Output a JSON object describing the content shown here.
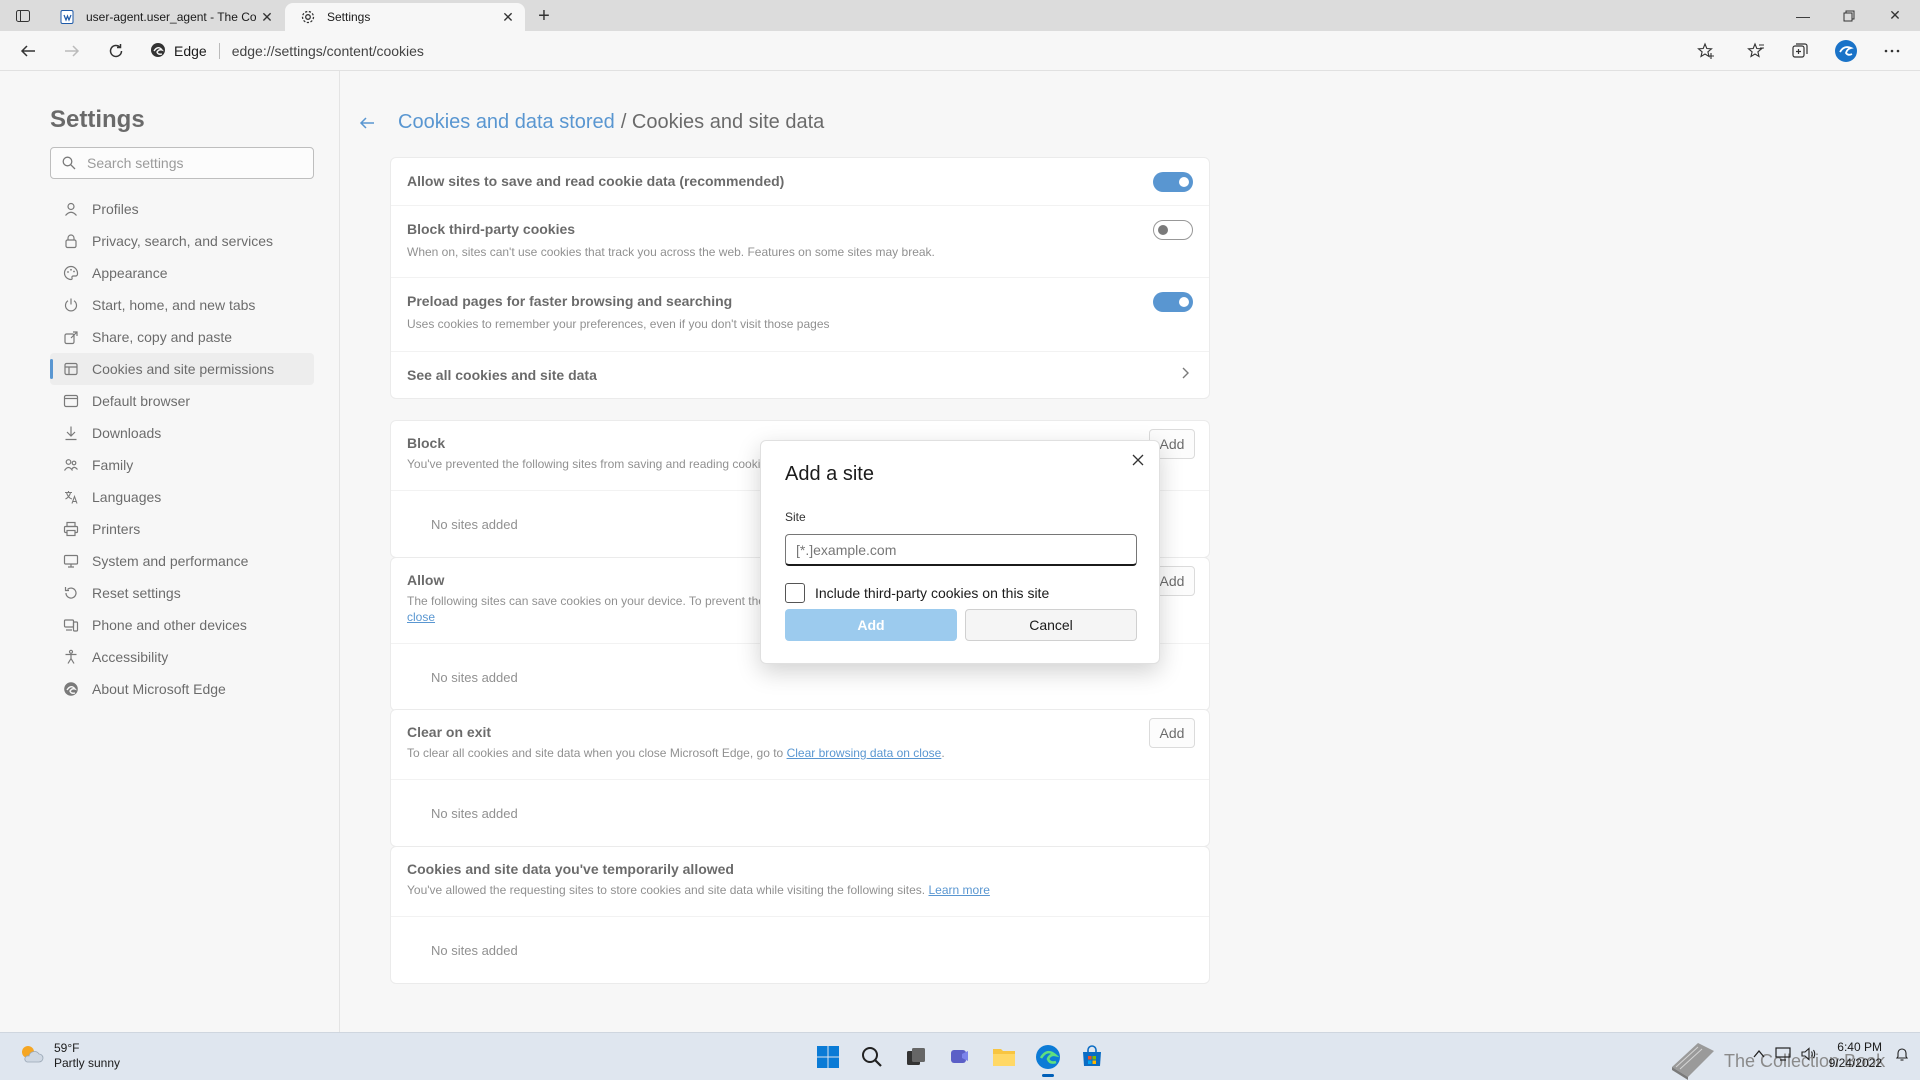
{
  "browser": {
    "tabs": [
      {
        "title": "user-agent.user_agent - The Col",
        "active": false
      },
      {
        "title": "Settings",
        "active": true
      }
    ],
    "address": {
      "badge": "Edge",
      "url": "edge://settings/content/cookies"
    }
  },
  "sidebar": {
    "title": "Settings",
    "search_placeholder": "Search settings",
    "items": [
      {
        "label": "Profiles",
        "icon": "profile-icon"
      },
      {
        "label": "Privacy, search, and services",
        "icon": "lock-icon"
      },
      {
        "label": "Appearance",
        "icon": "palette-icon"
      },
      {
        "label": "Start, home, and new tabs",
        "icon": "power-icon"
      },
      {
        "label": "Share, copy and paste",
        "icon": "share-icon"
      },
      {
        "label": "Cookies and site permissions",
        "icon": "cookie-icon",
        "active": true
      },
      {
        "label": "Default browser",
        "icon": "browser-icon"
      },
      {
        "label": "Downloads",
        "icon": "download-icon"
      },
      {
        "label": "Family",
        "icon": "family-icon"
      },
      {
        "label": "Languages",
        "icon": "language-icon"
      },
      {
        "label": "Printers",
        "icon": "printer-icon"
      },
      {
        "label": "System and performance",
        "icon": "system-icon"
      },
      {
        "label": "Reset settings",
        "icon": "reset-icon"
      },
      {
        "label": "Phone and other devices",
        "icon": "phone-icon"
      },
      {
        "label": "Accessibility",
        "icon": "accessibility-icon"
      },
      {
        "label": "About Microsoft Edge",
        "icon": "edge-icon"
      }
    ]
  },
  "main": {
    "breadcrumb_link": "Cookies and data stored",
    "breadcrumb_rest": "/ Cookies and site data",
    "settings": {
      "allow_title": "Allow sites to save and read cookie data (recommended)",
      "allow_on": true,
      "block3p_title": "Block third-party cookies",
      "block3p_desc": "When on, sites can't use cookies that track you across the web. Features on some sites may break.",
      "block3p_on": false,
      "preload_title": "Preload pages for faster browsing and searching",
      "preload_desc": "Uses cookies to remember your preferences, even if you don't visit those pages",
      "preload_on": true,
      "see_all": "See all cookies and site data"
    },
    "block": {
      "title": "Block",
      "desc": "You've prevented the following sites from saving and reading cooki",
      "add": "Add",
      "empty": "No sites added"
    },
    "allow": {
      "title": "Allow",
      "desc": "The following sites can save cookies on your device. To prevent the",
      "desc_link": "close",
      "add": "Add",
      "empty": "No sites added"
    },
    "clear": {
      "title": "Clear on exit",
      "desc": "To clear all cookies and site data when you close Microsoft Edge, go to",
      "desc_link": "Clear browsing data on close",
      "add": "Add",
      "empty": "No sites added"
    },
    "temp": {
      "title": "Cookies and site data you've temporarily allowed",
      "desc": "You've allowed the requesting sites to store cookies and site data while visiting the following sites.",
      "desc_link": "Learn more",
      "empty": "No sites added"
    }
  },
  "dialog": {
    "title": "Add a site",
    "site_label": "Site",
    "site_placeholder": "[*.]example.com",
    "site_value": "",
    "checkbox_label": "Include third-party cookies on this site",
    "checkbox_checked": false,
    "add": "Add",
    "cancel": "Cancel"
  },
  "taskbar": {
    "weather_temp": "59°F",
    "weather_desc": "Partly sunny",
    "time": "6:40 PM",
    "date": "9/24/2022",
    "watermark": "The Collection Book"
  },
  "colors": {
    "accent": "#005fb8",
    "add_disabled": "#9ccbee"
  }
}
